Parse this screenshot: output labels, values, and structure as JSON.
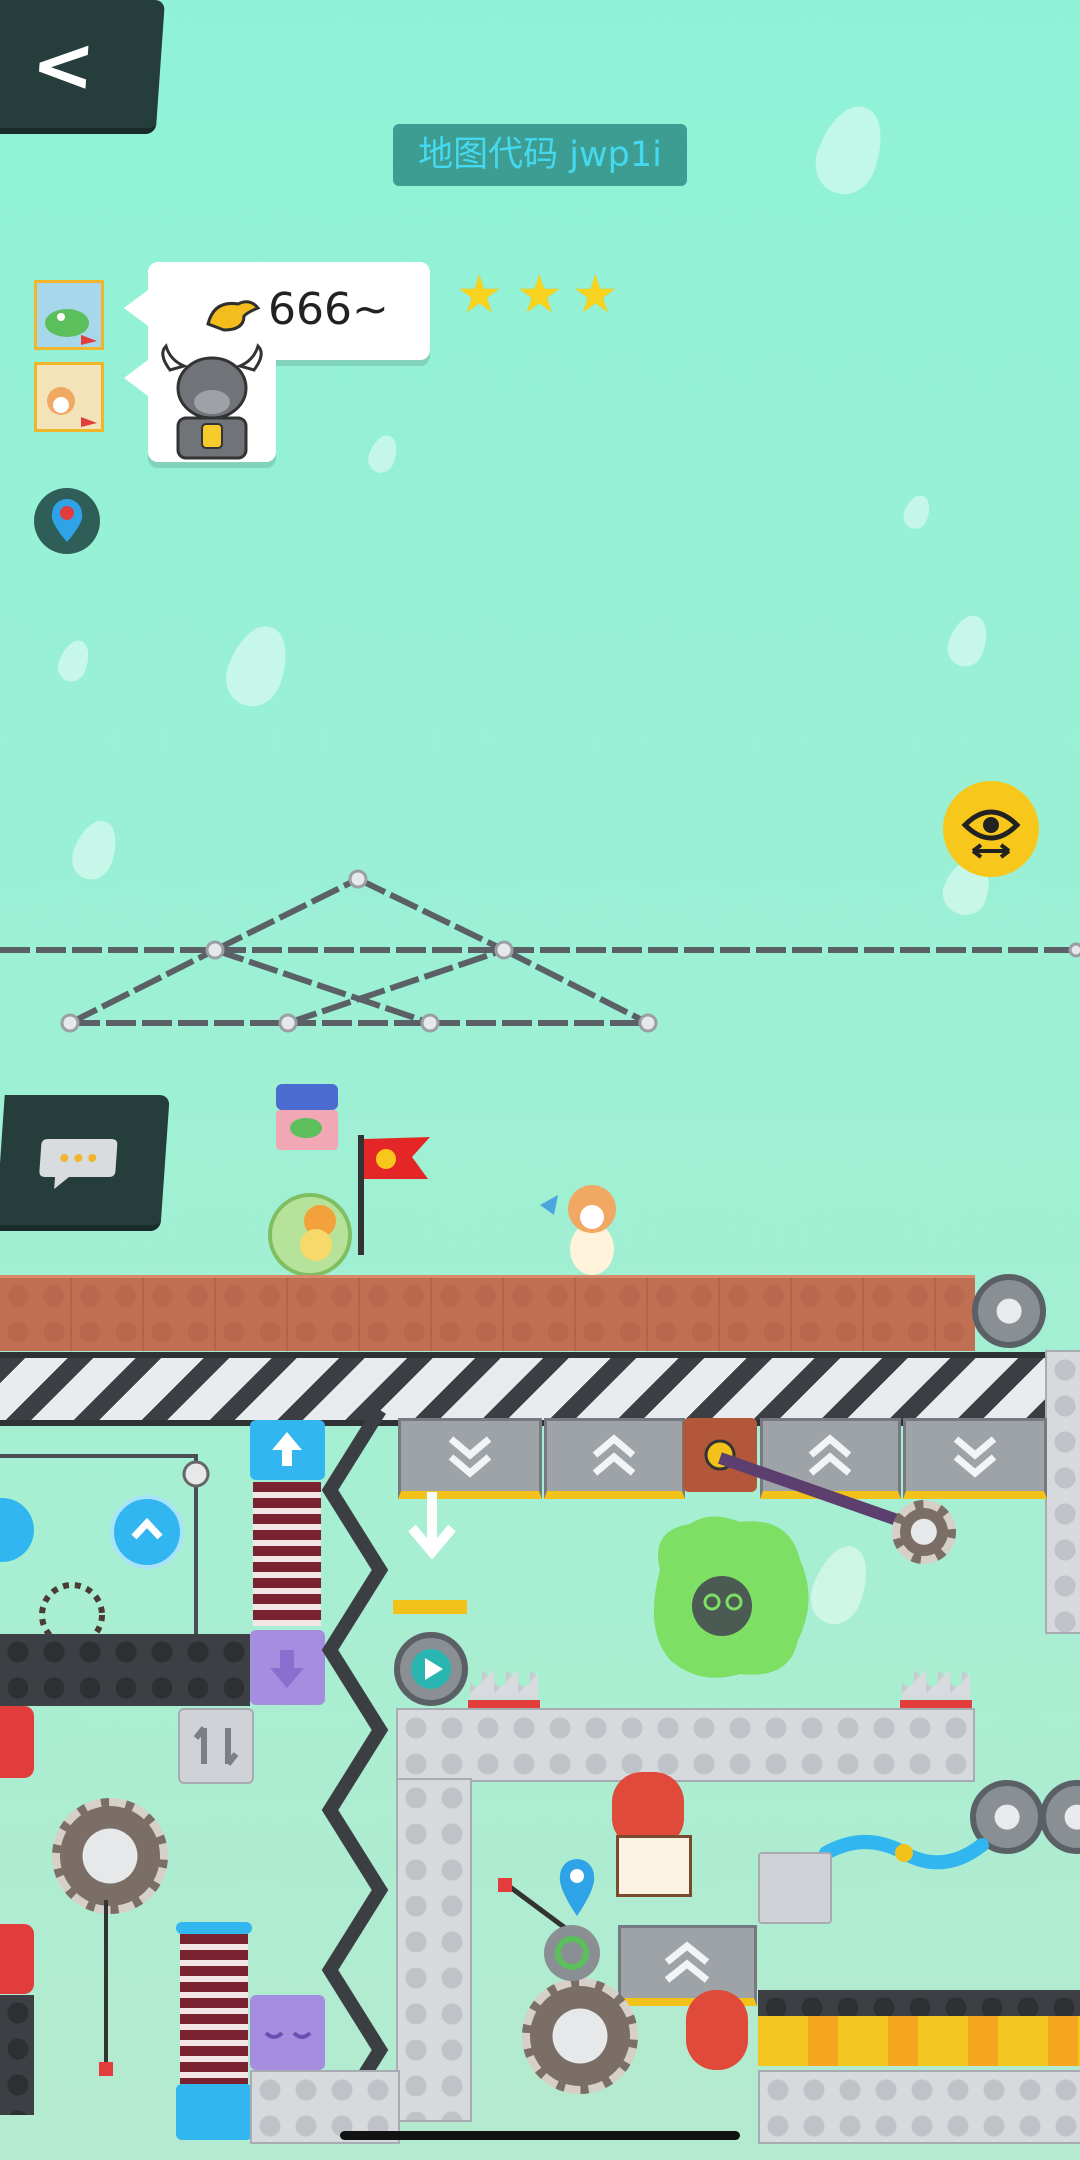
{
  "header": {
    "back_label": "<",
    "map_code": "地图代码 jwp1i"
  },
  "comment": {
    "text": "666~"
  },
  "rating": {
    "stars": 3,
    "star_char": "★"
  },
  "icons": {
    "back": "chevron-left-icon",
    "location": "location-pin-icon",
    "view": "eye-swap-icon",
    "chat": "chat-bubble-icon"
  },
  "colors": {
    "accent_yellow": "#f7c81b",
    "panel_dark": "#263e3b",
    "map_code_text": "#45d9ef"
  }
}
